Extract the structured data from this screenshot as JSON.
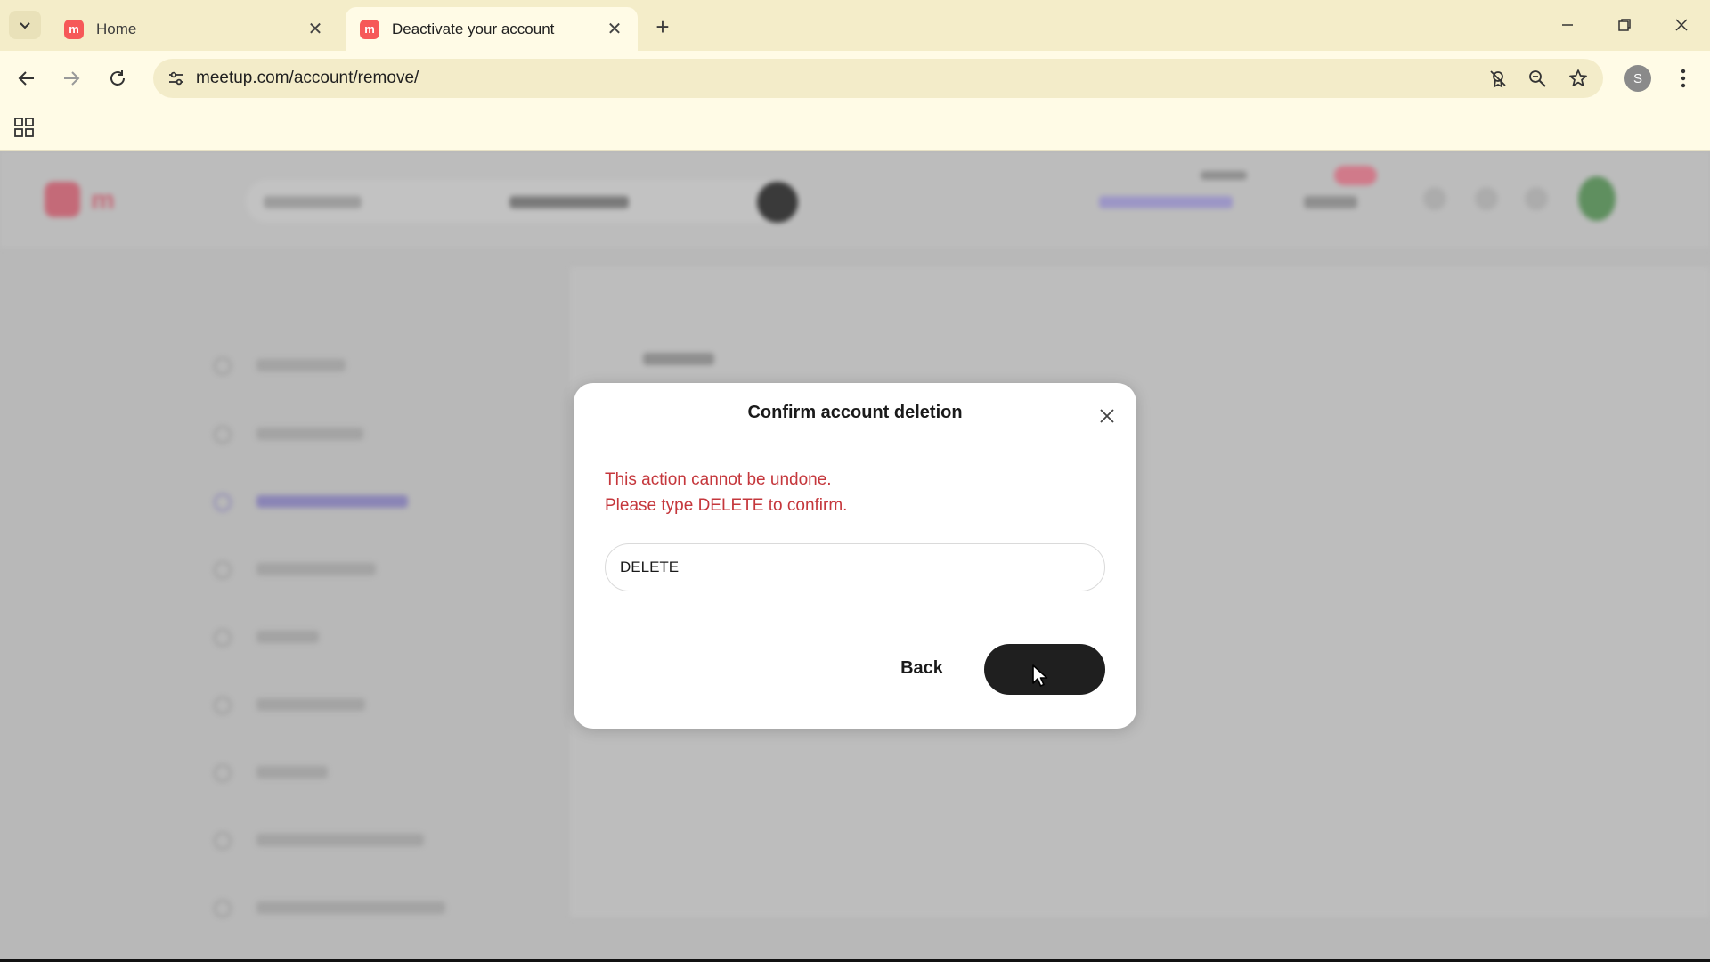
{
  "browser": {
    "tabs": [
      {
        "title": "Home",
        "favicon": "meetup-favicon"
      },
      {
        "title": "Deactivate your account",
        "favicon": "meetup-favicon"
      }
    ],
    "url": "meetup.com/account/remove/",
    "profile_initial": "S"
  },
  "modal": {
    "title": "Confirm account deletion",
    "warning_line1": "This action cannot be undone.",
    "warning_line2": "Please type DELETE to confirm.",
    "input_value": "DELETE",
    "back_label": "Back",
    "colors": {
      "warning": "#c5373c",
      "confirm_button": "#1f1f1f"
    }
  }
}
